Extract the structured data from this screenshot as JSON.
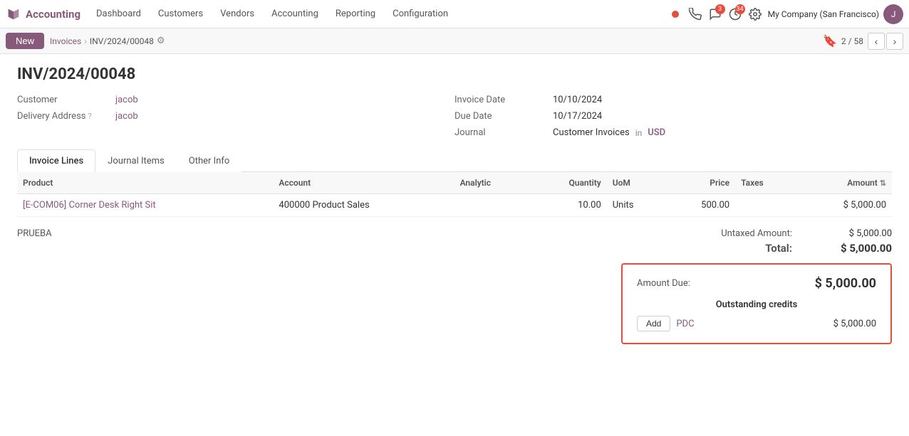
{
  "app": {
    "name": "Accounting"
  },
  "nav": {
    "logo_text": "Accounting",
    "items": [
      "Dashboard",
      "Customers",
      "Vendors",
      "Accounting",
      "Reporting",
      "Configuration"
    ],
    "company": "My Company (San Francisco)",
    "badges": {
      "phone": null,
      "chat": "3",
      "activity": "34"
    }
  },
  "toolbar": {
    "new_label": "New",
    "breadcrumb_parent": "Invoices",
    "breadcrumb_current": "INV/2024/00048",
    "page_info": "2 / 58"
  },
  "invoice": {
    "title": "INV/2024/00048",
    "customer_label": "Customer",
    "customer_value": "jacob",
    "delivery_address_label": "Delivery Address",
    "delivery_address_value": "jacob",
    "invoice_date_label": "Invoice Date",
    "invoice_date_value": "10/10/2024",
    "due_date_label": "Due Date",
    "due_date_value": "10/17/2024",
    "journal_label": "Journal",
    "journal_value": "Customer Invoices",
    "journal_in": "in",
    "journal_currency": "USD"
  },
  "tabs": [
    {
      "id": "invoice-lines",
      "label": "Invoice Lines",
      "active": true
    },
    {
      "id": "journal-items",
      "label": "Journal Items",
      "active": false
    },
    {
      "id": "other-info",
      "label": "Other Info",
      "active": false
    }
  ],
  "table": {
    "columns": [
      "Product",
      "Account",
      "Analytic",
      "Quantity",
      "UoM",
      "Price",
      "Taxes",
      "Amount"
    ],
    "rows": [
      {
        "product": "[E-COM06] Corner Desk Right Sit",
        "account": "400000 Product Sales",
        "analytic": "",
        "quantity": "10.00",
        "uom": "Units",
        "price": "500.00",
        "taxes": "",
        "amount": "$ 5,000.00"
      }
    ]
  },
  "footer": {
    "notes": "PRUEBA",
    "untaxed_label": "Untaxed Amount:",
    "untaxed_value": "$ 5,000.00",
    "total_label": "Total:",
    "total_value": "$ 5,000.00"
  },
  "amount_due": {
    "label": "Amount Due:",
    "value": "$ 5,000.00",
    "outstanding_title": "Outstanding credits",
    "add_label": "Add",
    "pdc_label": "PDC",
    "pdc_amount": "$ 5,000.00"
  }
}
